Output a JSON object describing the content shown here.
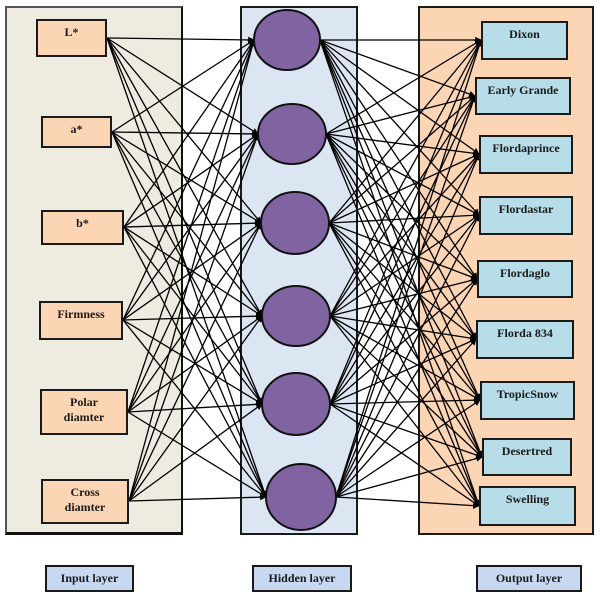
{
  "colors": {
    "input_panel_bg": "#eeece1",
    "hidden_panel_bg": "#dce6f2",
    "output_panel_bg": "#fcd5b5",
    "input_node_fill": "#fcd5b5",
    "output_node_fill": "#b7dde8",
    "hidden_node_fill": "#8064a2",
    "layer_label_fill": "#c6d9f1",
    "edge_color": "#000000"
  },
  "input_layer": {
    "label": "Input layer",
    "nodes": [
      {
        "lines": [
          "L*"
        ]
      },
      {
        "lines": [
          "a*"
        ]
      },
      {
        "lines": [
          "b*"
        ]
      },
      {
        "lines": [
          "Firmness"
        ]
      },
      {
        "lines": [
          "Polar",
          "diamter"
        ]
      },
      {
        "lines": [
          "Cross",
          "diamter"
        ]
      }
    ]
  },
  "hidden_layer": {
    "label": "Hidden layer",
    "node_count": 6
  },
  "output_layer": {
    "label": "Output layer",
    "nodes": [
      {
        "lines": [
          "Dixon"
        ]
      },
      {
        "lines": [
          "Early Grande"
        ]
      },
      {
        "lines": [
          "Flordaprince"
        ]
      },
      {
        "lines": [
          "Flordastar"
        ]
      },
      {
        "lines": [
          "Flordaglo"
        ]
      },
      {
        "lines": [
          "Florda 834"
        ]
      },
      {
        "lines": [
          "TropicSnow"
        ]
      },
      {
        "lines": [
          "Desertred"
        ]
      },
      {
        "lines": [
          "Swelling"
        ]
      }
    ]
  },
  "connectivity": "fully-connected"
}
